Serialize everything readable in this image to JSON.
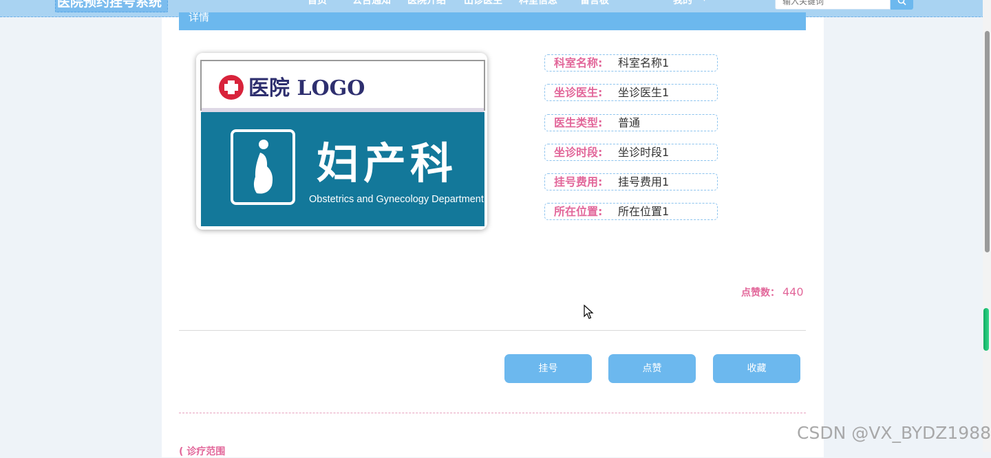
{
  "header": {
    "brand": "医院预约挂号系统",
    "nav": [
      "首页",
      "公告通知",
      "医院介绍",
      "出诊医生",
      "科室信息",
      "留言板",
      "我的"
    ],
    "search": {
      "placeholder": "输入关键词"
    }
  },
  "detail": {
    "section_title": "详情",
    "image": {
      "logo_text": "医院 LOGO",
      "department_cn": "妇产科",
      "department_en": "Obstetrics and Gynecology Department"
    },
    "fields": [
      {
        "label": "科室名称:",
        "value": "科室名称1"
      },
      {
        "label": "坐诊医生:",
        "value": "坐诊医生1"
      },
      {
        "label": "医生类型:",
        "value": "普通"
      },
      {
        "label": "坐诊时段:",
        "value": "坐诊时段1"
      },
      {
        "label": "挂号费用:",
        "value": "挂号费用1"
      },
      {
        "label": "所在位置:",
        "value": "所在位置1"
      }
    ],
    "likes": {
      "label": "点赞数：",
      "value": "440"
    },
    "buttons": {
      "register": "挂号",
      "like": "点赞",
      "favorite": "收藏"
    },
    "next_section": "诊疗范围"
  },
  "watermark": "CSDN @VX_BYDZ1988",
  "colors": {
    "primary": "#6cb8ee",
    "label_pink": "#e2679a",
    "sign_teal": "#13789a"
  }
}
